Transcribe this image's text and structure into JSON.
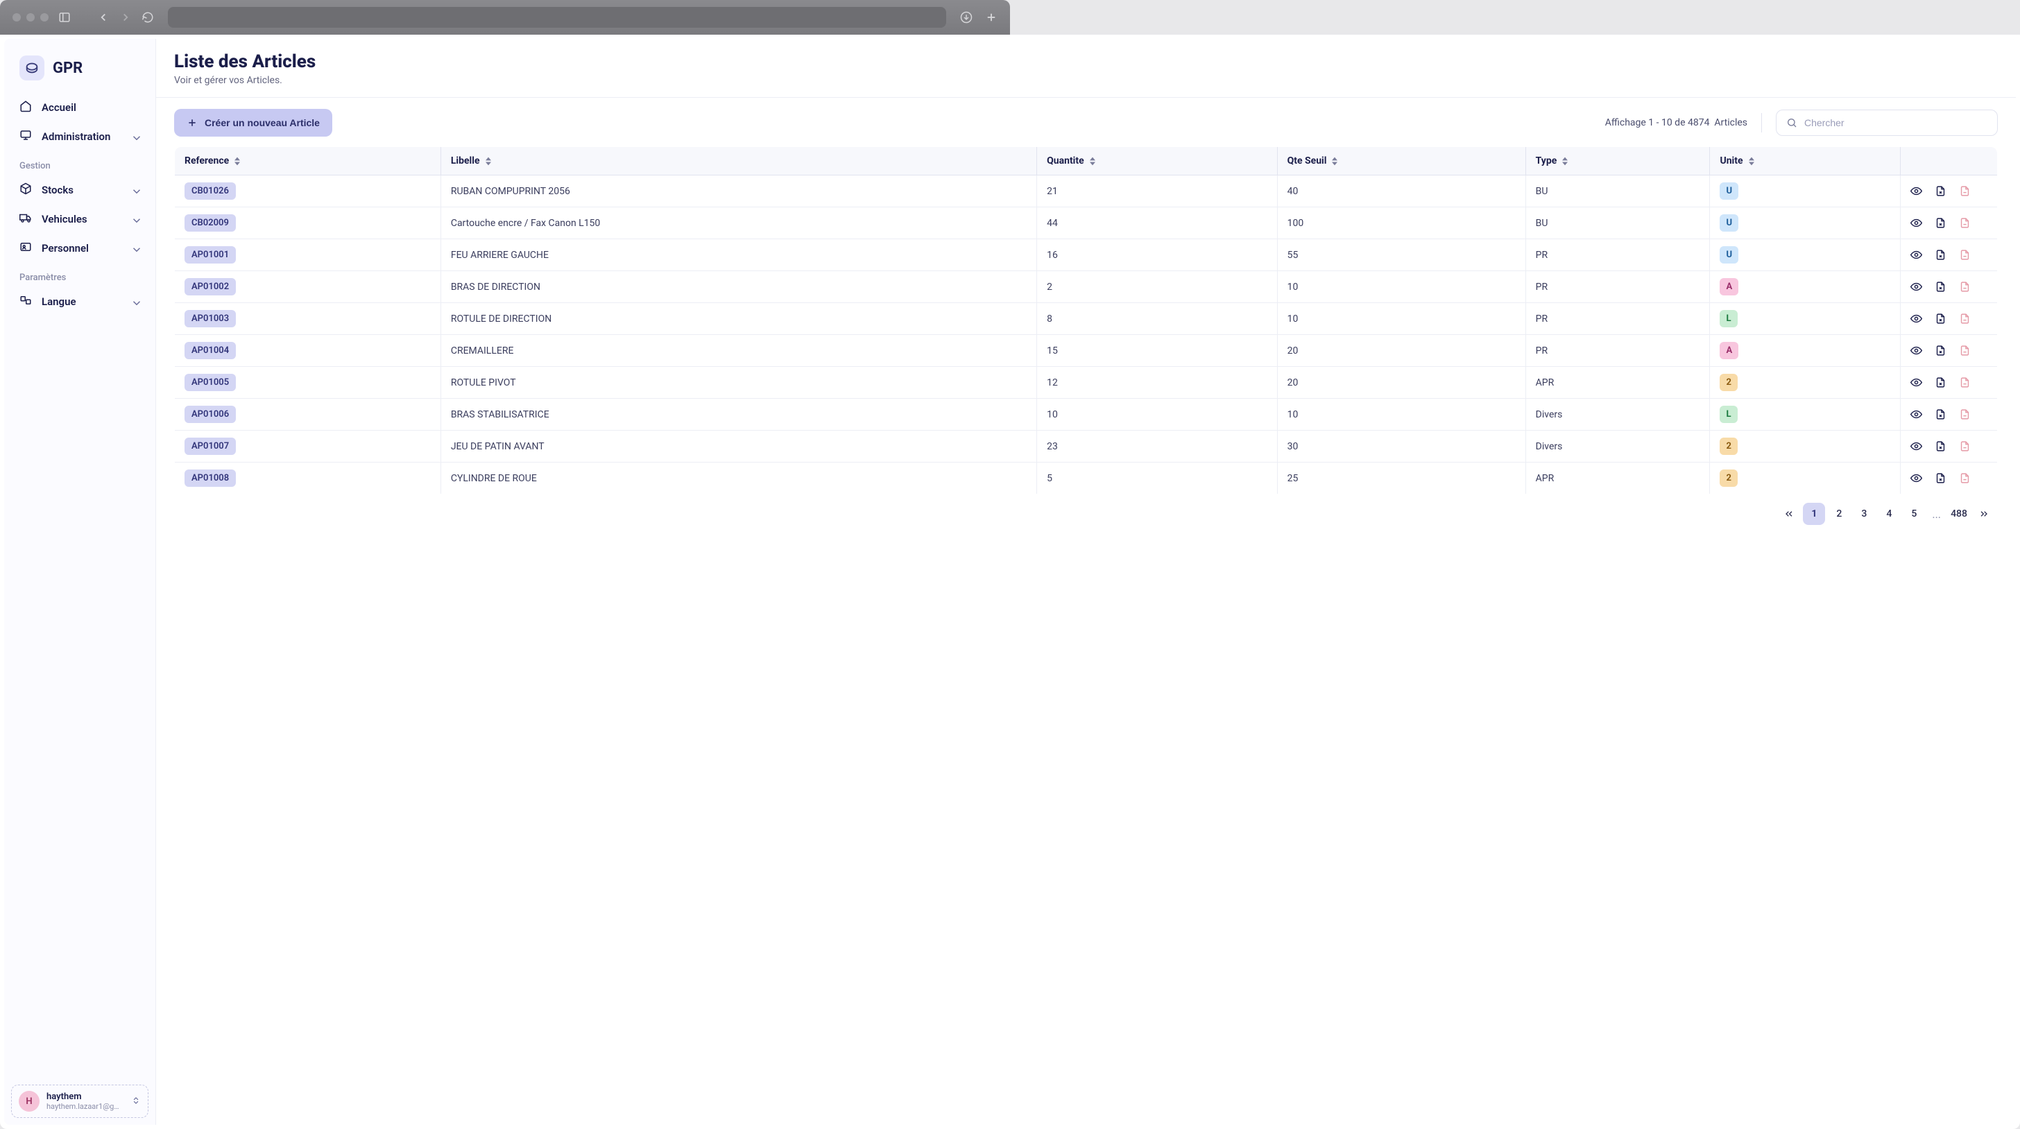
{
  "app": {
    "name": "GPR"
  },
  "sidebar": {
    "items": [
      {
        "label": "Accueil",
        "icon": "home",
        "expandable": false
      },
      {
        "label": "Administration",
        "icon": "monitor",
        "expandable": true
      }
    ],
    "sections": [
      {
        "label": "Gestion",
        "items": [
          {
            "label": "Stocks",
            "icon": "box",
            "expandable": true
          },
          {
            "label": "Vehicules",
            "icon": "truck",
            "expandable": true
          },
          {
            "label": "Personnel",
            "icon": "id-card",
            "expandable": true
          }
        ]
      },
      {
        "label": "Paramètres",
        "items": [
          {
            "label": "Langue",
            "icon": "language",
            "expandable": true
          }
        ]
      }
    ]
  },
  "user": {
    "initial": "H",
    "name": "haythem",
    "email": "haythem.lazaar1@gm..."
  },
  "header": {
    "title": "Liste des Articles",
    "subtitle": "Voir et gérer vos Articles."
  },
  "toolbar": {
    "create_label": "Créer un nouveau Article",
    "count_prefix": "Affichage 1 - 10 de 4874",
    "count_suffix": "Articles",
    "search_placeholder": "Chercher"
  },
  "table": {
    "columns": [
      "Reference",
      "Libelle",
      "Quantite",
      "Qte Seuil",
      "Type",
      "Unite"
    ],
    "rows": [
      {
        "ref": "CB01026",
        "libelle": "RUBAN COMPUPRINT 2056",
        "qte": "21",
        "seuil": "40",
        "type": "BU",
        "unite": "U"
      },
      {
        "ref": "CB02009",
        "libelle": "Cartouche encre / Fax Canon L150",
        "qte": "44",
        "seuil": "100",
        "type": "BU",
        "unite": "U"
      },
      {
        "ref": "AP01001",
        "libelle": "FEU ARRIERE GAUCHE",
        "qte": "16",
        "seuil": "55",
        "type": "PR",
        "unite": "U"
      },
      {
        "ref": "AP01002",
        "libelle": "BRAS DE DIRECTION",
        "qte": "2",
        "seuil": "10",
        "type": "PR",
        "unite": "A"
      },
      {
        "ref": "AP01003",
        "libelle": "ROTULE DE DIRECTION",
        "qte": "8",
        "seuil": "10",
        "type": "PR",
        "unite": "L"
      },
      {
        "ref": "AP01004",
        "libelle": "CREMAILLERE",
        "qte": "15",
        "seuil": "20",
        "type": "PR",
        "unite": "A"
      },
      {
        "ref": "AP01005",
        "libelle": "ROTULE PIVOT",
        "qte": "12",
        "seuil": "20",
        "type": "APR",
        "unite": "2"
      },
      {
        "ref": "AP01006",
        "libelle": "BRAS STABILISATRICE",
        "qte": "10",
        "seuil": "10",
        "type": "Divers",
        "unite": "L"
      },
      {
        "ref": "AP01007",
        "libelle": "JEU DE PATIN AVANT",
        "qte": "23",
        "seuil": "30",
        "type": "Divers",
        "unite": "2"
      },
      {
        "ref": "AP01008",
        "libelle": "CYLINDRE DE ROUE",
        "qte": "5",
        "seuil": "25",
        "type": "APR",
        "unite": "2"
      }
    ]
  },
  "pagination": {
    "pages": [
      "1",
      "2",
      "3",
      "4",
      "5"
    ],
    "last": "488",
    "active": "1"
  }
}
